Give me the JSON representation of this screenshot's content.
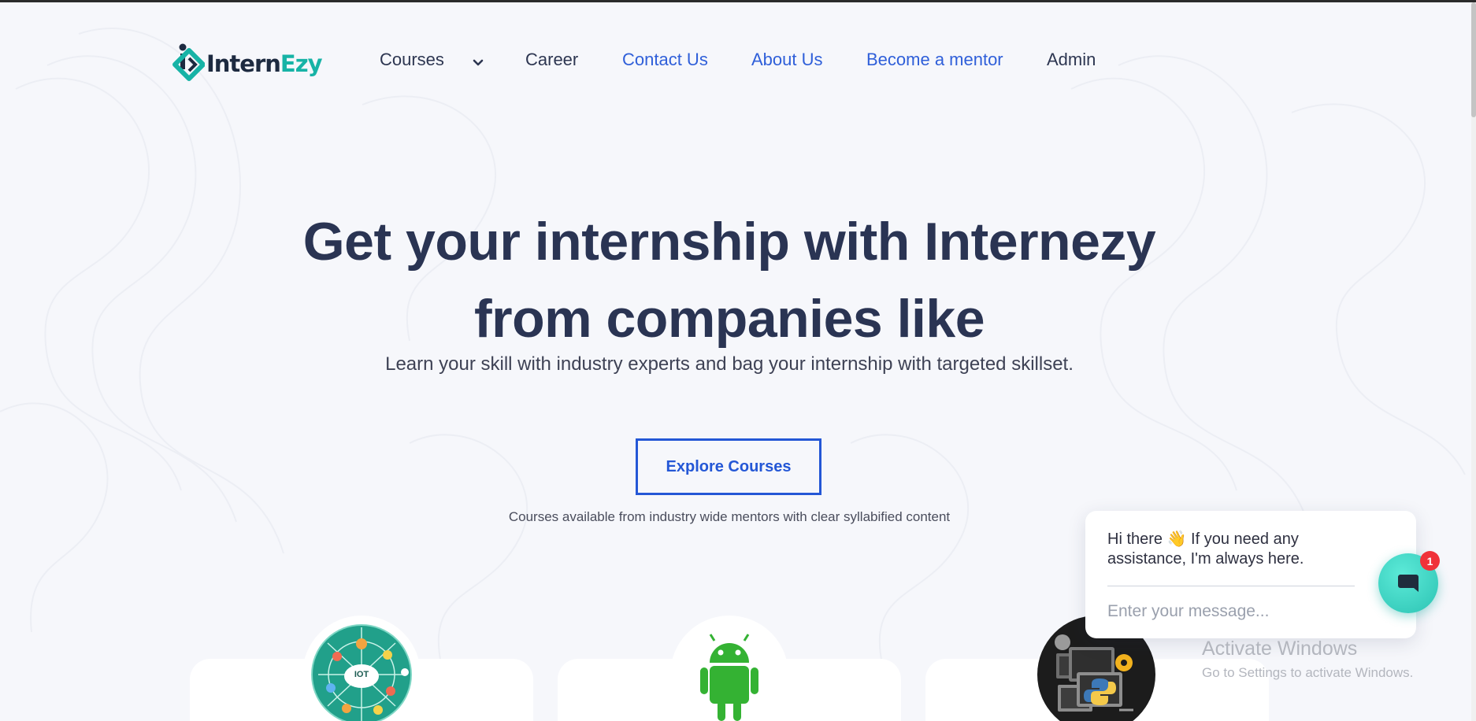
{
  "brand": {
    "name_part1": "Intern",
    "name_part2": "Ezy"
  },
  "nav": {
    "items": [
      {
        "label": "Courses"
      },
      {
        "label": "Career"
      },
      {
        "label": "Contact Us"
      },
      {
        "label": "About Us"
      },
      {
        "label": "Become a mentor"
      },
      {
        "label": "Admin"
      }
    ]
  },
  "hero": {
    "title_line1": "Get your internship with Internezy",
    "title_line2": "from companies like",
    "subtitle": "Learn your skill with industry experts and bag your internship with targeted skillset.",
    "cta_label": "Explore Courses",
    "note": "Courses available from industry wide mentors with clear syllabified content"
  },
  "course_cards": [
    {
      "icon": "iot-globe-icon",
      "icon_text": "IOT"
    },
    {
      "icon": "android-icon"
    },
    {
      "icon": "python-computer-icon"
    }
  ],
  "chat": {
    "greeting": "Hi there 👋 If you need any assistance, I'm always here.",
    "placeholder": "Enter your message...",
    "badge_count": "1"
  },
  "system_overlay": {
    "title": "Activate Windows",
    "subtitle": "Go to Settings to activate Windows."
  },
  "colors": {
    "accent_blue": "#2457d6",
    "brand_teal": "#17b3a6",
    "heading": "#2a3453",
    "background": "#f6f7fb"
  }
}
